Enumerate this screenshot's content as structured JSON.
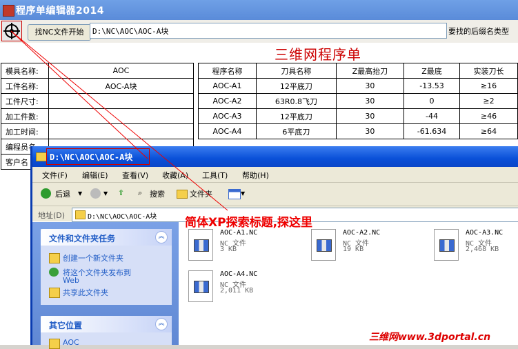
{
  "app": {
    "title": "程序单编辑器2014",
    "find_button": "找NC文件开始",
    "path_value": "D:\\NC\\AOC\\AOC-A块",
    "hint": "要找的后缀名类型",
    "sheet_title": "三维网程序单"
  },
  "info_table": [
    {
      "label": "模具名称:",
      "value": "AOC"
    },
    {
      "label": "工件名称:",
      "value": "AOC-A块"
    },
    {
      "label": "工件尺寸:",
      "value": ""
    },
    {
      "label": "加工件数:",
      "value": ""
    },
    {
      "label": "加工时间:",
      "value": ""
    },
    {
      "label": "编程员名",
      "value": ""
    },
    {
      "label": "客户名",
      "value": ""
    }
  ],
  "tool_table": {
    "headers": [
      "程序名称",
      "刀具名称",
      "Z最高抬刀",
      "Z最底",
      "实装刀长"
    ],
    "rows": [
      [
        "AOC-A1",
        "12平底刀",
        "30",
        "-13.53",
        "≥16"
      ],
      [
        "AOC-A2",
        "63R0.8飞刀",
        "30",
        "0",
        "≥2"
      ],
      [
        "AOC-A3",
        "12平底刀",
        "30",
        "-44",
        "≥46"
      ],
      [
        "AOC-A4",
        "6平底刀",
        "30",
        "-61.634",
        "≥64"
      ]
    ]
  },
  "explorer": {
    "title": "D:\\NC\\AOC\\AOC-A块",
    "menu": [
      "文件(F)",
      "编辑(E)",
      "查看(V)",
      "收藏(A)",
      "工具(T)",
      "帮助(H)"
    ],
    "buttons": {
      "back": "后退",
      "search": "搜索",
      "folders": "文件夹"
    },
    "address_label": "地址(D)",
    "address_value": "D:\\NC\\AOC\\AOC-A块",
    "tasks_panel": {
      "title": "文件和文件夹任务",
      "items": [
        "创建一个新文件夹",
        "将这个文件夹发布到",
        "Web",
        "共享此文件夹"
      ]
    },
    "other_panel": {
      "title": "其它位置",
      "items": [
        "AOC"
      ]
    },
    "files": [
      {
        "name": "AOC-A1.NC",
        "type": "NC 文件",
        "size": "3 KB"
      },
      {
        "name": "AOC-A2.NC",
        "type": "NC 文件",
        "size": "19 KB"
      },
      {
        "name": "AOC-A3.NC",
        "type": "NC 文件",
        "size": "2,468 KB"
      },
      {
        "name": "AOC-A4.NC",
        "type": "NC 文件",
        "size": "2,011 KB"
      }
    ]
  },
  "annotation": "简体XP探索标题,探这里",
  "watermark": "三维网www.3dportal.cn",
  "colors": {
    "accent_red": "#cc0000",
    "xp_blue": "#0a50d8"
  }
}
